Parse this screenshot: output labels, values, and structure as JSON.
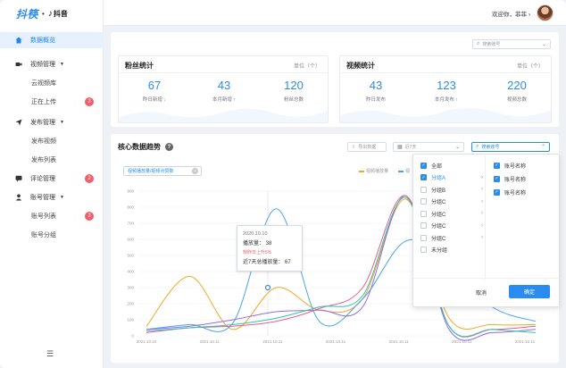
{
  "brand": {
    "logo_text": "抖筷",
    "dot": "•",
    "tiktok_label": "抖音"
  },
  "header": {
    "welcome": "欢迎你，菲菲 ›"
  },
  "sidebar": {
    "items": [
      {
        "label": "数据概览"
      },
      {
        "label": "视频管理"
      },
      {
        "label": "云视频库"
      },
      {
        "label": "正在上传",
        "badge": "2"
      },
      {
        "label": "发布管理"
      },
      {
        "label": "发布视频"
      },
      {
        "label": "发布列表"
      },
      {
        "label": "评论管理",
        "badge": "2"
      },
      {
        "label": "账号管理"
      },
      {
        "label": "账号列表",
        "badge": "2"
      },
      {
        "label": "账号分组"
      }
    ]
  },
  "top": {
    "account_placeholder": "搜索账号",
    "fans": {
      "title": "粉丝统计",
      "unit": "单位（个）",
      "stats": [
        {
          "value": "67",
          "label": "昨日新增"
        },
        {
          "value": "43",
          "label": "本月新增"
        },
        {
          "value": "120",
          "label": "粉丝总数"
        }
      ]
    },
    "videos": {
      "title": "视频统计",
      "unit": "单位（个）",
      "stats": [
        {
          "value": "43",
          "label": "昨日发布"
        },
        {
          "value": "123",
          "label": "本月发布"
        },
        {
          "value": "220",
          "label": "视频总数"
        }
      ]
    }
  },
  "trend": {
    "title": "核心数据趋势",
    "export_label": "导出数据",
    "period_placeholder": "近7天",
    "account_placeholder": "搜索账号",
    "tag": "视频播放量/视频点赞数",
    "legend": [
      {
        "name": "视频播放量"
      },
      {
        "name": "视"
      }
    ],
    "tooltip": {
      "date": "2020.10.10",
      "plays": "播放量：  38",
      "rate": "较昨日上升5%",
      "week": "近7天总播放量：  67"
    }
  },
  "dropdown": {
    "groups": [
      {
        "label": "全部",
        "checked": true
      },
      {
        "label": "分组A",
        "checked": true
      },
      {
        "label": "分组B",
        "checked": false
      },
      {
        "label": "分组C",
        "checked": false
      },
      {
        "label": "分组C",
        "checked": false
      },
      {
        "label": "分组C",
        "checked": false
      },
      {
        "label": "分组C",
        "checked": false
      },
      {
        "label": "未分组",
        "checked": false
      }
    ],
    "accounts": [
      {
        "label": "账号名称",
        "checked": true
      },
      {
        "label": "账号名称",
        "checked": true
      },
      {
        "label": "账号名称",
        "checked": true
      }
    ],
    "cancel": "取消",
    "confirm": "确定"
  },
  "chart_data": {
    "type": "line",
    "yticks": [
      "900",
      "800",
      "700",
      "600",
      "500",
      "400",
      "300",
      "200",
      "100",
      "0"
    ],
    "xticks": [
      "2021.10.10",
      "2021.10.11",
      "2021.10.11",
      "2021.10.11",
      "2021.10.11",
      "2021.10.11",
      "2021.10.11"
    ],
    "ylim": [
      0,
      900
    ],
    "series": [
      {
        "color": "#f5a623",
        "values": [
          60,
          370,
          40,
          300,
          160,
          230,
          850,
          110,
          70,
          70
        ]
      },
      {
        "color": "#4aa3f0",
        "values": [
          40,
          70,
          80,
          790,
          90,
          230,
          590,
          460,
          180,
          90
        ]
      },
      {
        "color": "#8c6cf0",
        "values": [
          40,
          60,
          100,
          150,
          160,
          180,
          870,
          40,
          20,
          40
        ]
      },
      {
        "color": "#f05a8c",
        "values": [
          20,
          50,
          60,
          90,
          170,
          300,
          870,
          60,
          40,
          60
        ]
      },
      {
        "color": "#2cc5a6",
        "values": [
          30,
          50,
          70,
          110,
          180,
          250,
          860,
          60,
          40,
          20
        ]
      }
    ]
  }
}
